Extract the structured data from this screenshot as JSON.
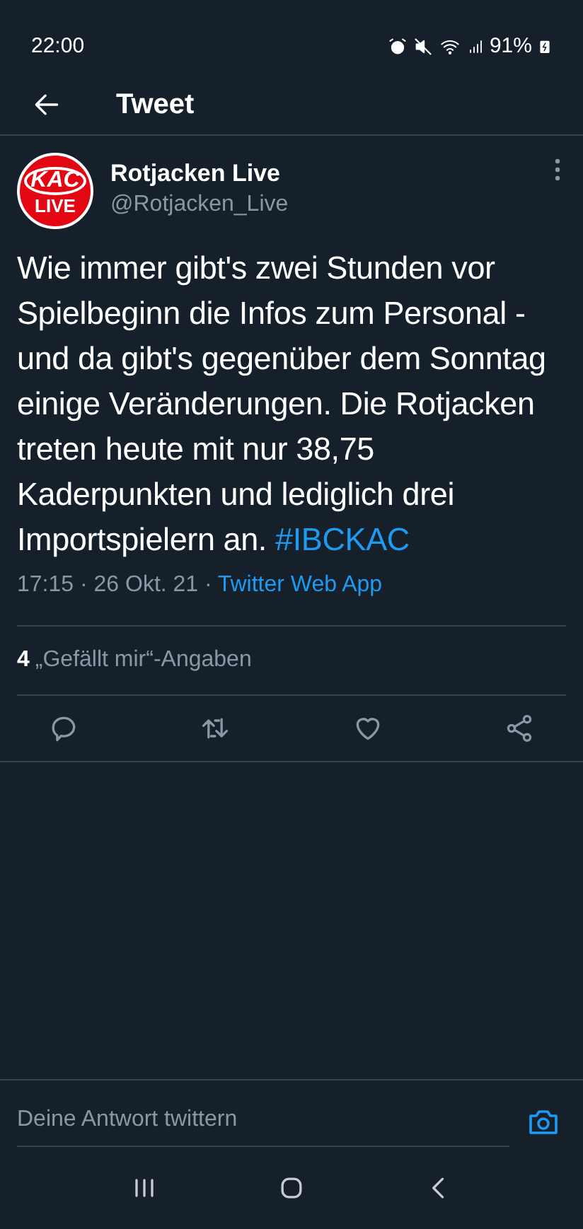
{
  "status_bar": {
    "time": "22:00",
    "battery": "91%"
  },
  "header": {
    "title": "Tweet"
  },
  "author": {
    "avatar_top": "KAC",
    "avatar_bottom": "LIVE",
    "name": "Rotjacken Live",
    "handle": "@Rotjacken_Live"
  },
  "tweet": {
    "text": "Wie immer gibt's zwei Stunden vor Spielbeginn die Infos zum Personal - und da gibt's gegenüber dem Sonntag einige Veränderungen. Die Rotjacken treten heute mit nur 38,75 Kaderpunkten und lediglich drei Importspielern an.",
    "hashtag": "#IBCKAC",
    "time": "17:15 · 26 Okt. 21 ·",
    "source": "Twitter Web App"
  },
  "likes": {
    "count": "4",
    "label": "„Gefällt mir“-Angaben"
  },
  "reply": {
    "placeholder": "Deine Antwort twittern"
  }
}
